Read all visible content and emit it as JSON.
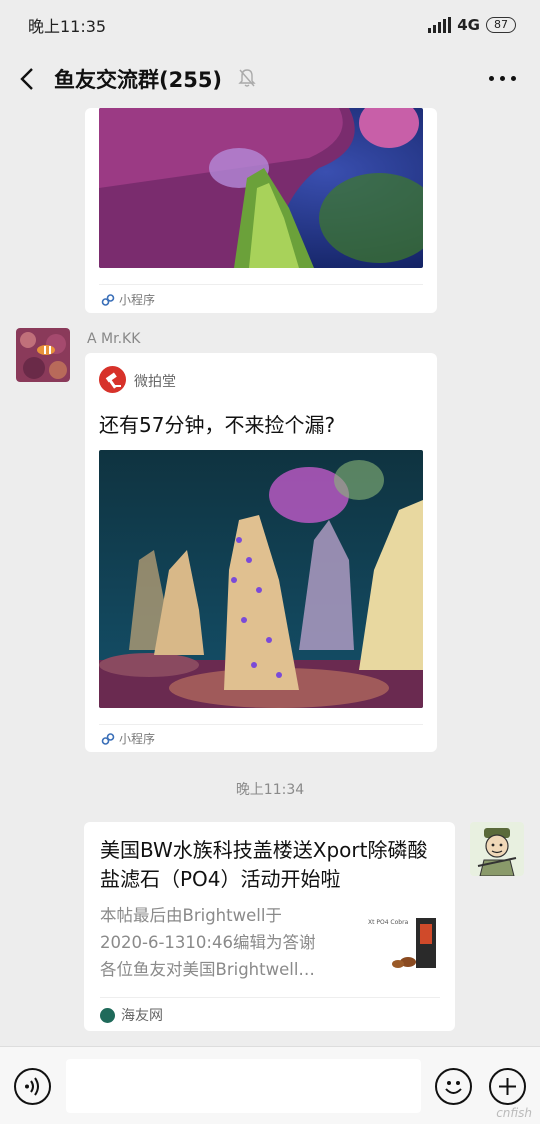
{
  "status_bar": {
    "time": "晚上11:35",
    "network": "4G",
    "battery": "87"
  },
  "header": {
    "title": "鱼友交流群(255)"
  },
  "messages": [
    {
      "type": "mini-program",
      "source": "小程序"
    },
    {
      "type": "mini-program",
      "sender": "A  Mr.KK",
      "app_name": "微拍堂",
      "text": "还有57分钟，不来捡个漏?",
      "source": "小程序"
    },
    {
      "type": "timestamp",
      "time": "晚上11:34"
    },
    {
      "type": "link-card",
      "title": "美国BW水族科技盖楼送Xport除磷酸盐滤石（PO4）活动开始啦",
      "desc": "本帖最后由Brightwell于2020-6-1310:46编辑为答谢各位鱼友对美国Brightwell…",
      "desc_line1": "本帖最后由Brightwell于",
      "desc_line2": "2020-6-1310:46编辑为答谢",
      "desc_line3": "各位鱼友对美国Brightwell…",
      "thumb_text": "Xt PO4 Cobra",
      "source": "海友网"
    }
  ],
  "watermark": "cnfish"
}
